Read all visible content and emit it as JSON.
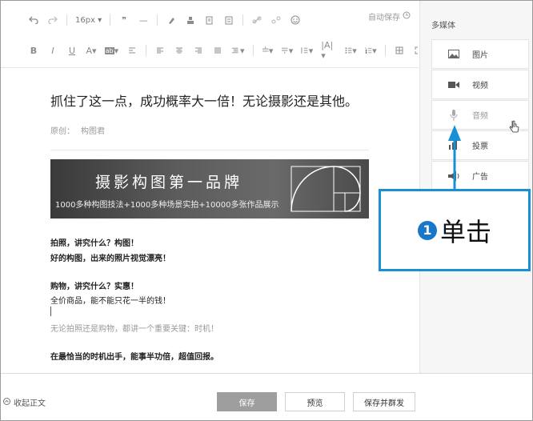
{
  "toolbar": {
    "font_size": "16px",
    "autosave": "自动保存"
  },
  "article": {
    "title": "抓住了这一点，成功概率大一倍！无论摄影还是其他。",
    "author_label": "原创：",
    "author_name": "构图君",
    "banner_title": "摄影构图第一品牌",
    "banner_sub": "1000多种构图技法+1000多种场景实拍+10000多张作品展示",
    "paragraphs": [
      "拍照，讲究什么？构图！",
      "好的构图，出来的照片视觉漂亮！",
      "购物，讲究什么？实惠！",
      "全价商品，能不能只花一半的钱！",
      "无论拍照还是购物，都讲一个重要关键：时机！",
      "在最恰当的时机出手，能事半功倍，超值回报。"
    ]
  },
  "footer": {
    "collapse": "收起正文",
    "save": "保存",
    "preview": "预览",
    "publish": "保存并群发"
  },
  "sidebar": {
    "title": "多媒体",
    "items": [
      {
        "label": "图片",
        "icon": "image-icon"
      },
      {
        "label": "视频",
        "icon": "video-icon"
      },
      {
        "label": "音频",
        "icon": "microphone-icon"
      },
      {
        "label": "投票",
        "icon": "bar-chart-icon"
      },
      {
        "label": "广告",
        "icon": "megaphone-icon"
      }
    ]
  },
  "callout": {
    "number": "1",
    "text": "单击"
  },
  "colors": {
    "callout_blue": "#1a8fd6",
    "badge_blue": "#1877c9",
    "save_gray": "#9e9e9e"
  }
}
